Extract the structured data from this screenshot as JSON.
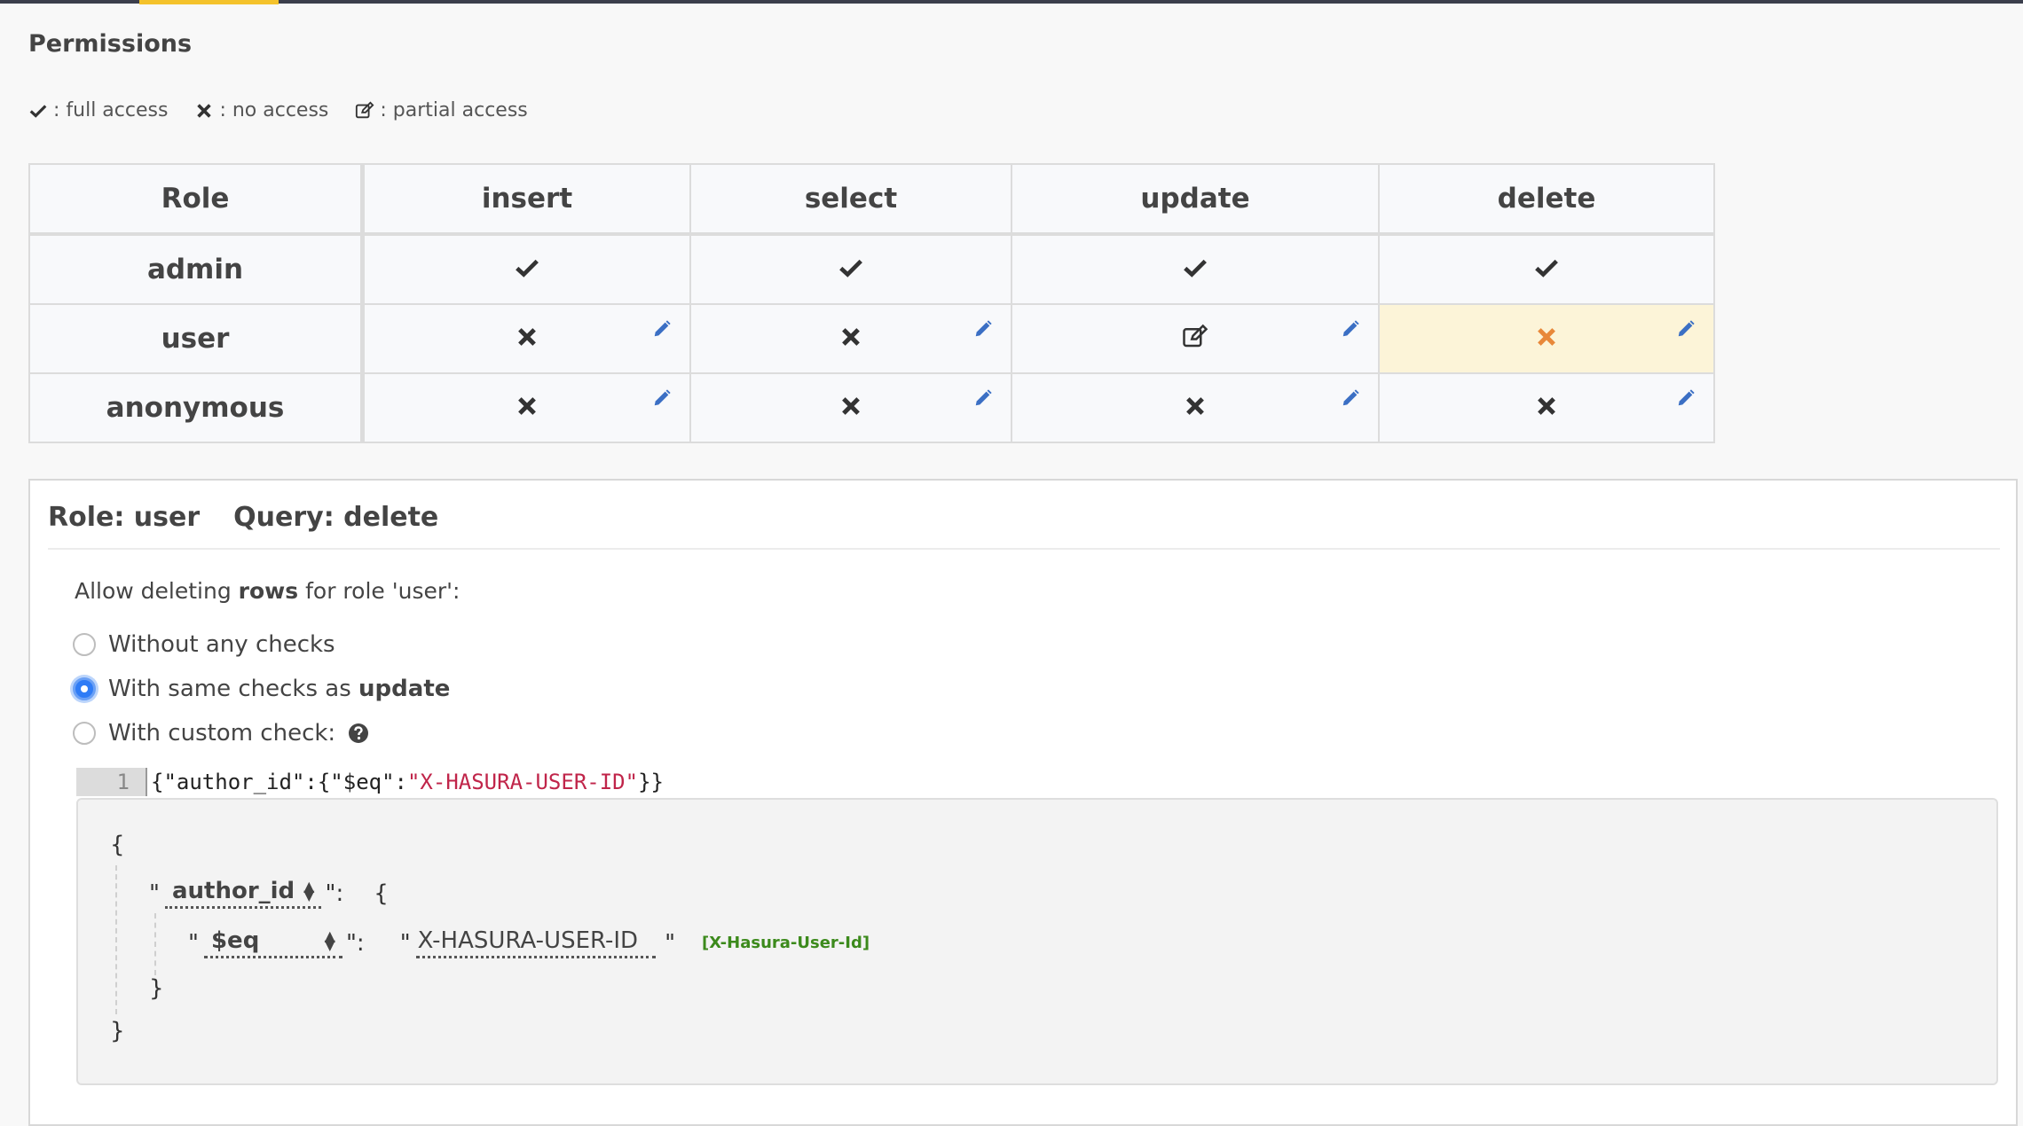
{
  "page": {
    "title": "Permissions"
  },
  "legend": {
    "full": ": full access",
    "none": ": no access",
    "partial": ": partial access"
  },
  "table": {
    "headers": [
      "Role",
      "insert",
      "select",
      "update",
      "delete"
    ],
    "rows": [
      {
        "role": "admin",
        "cells": [
          "full",
          "full",
          "full",
          "full"
        ]
      },
      {
        "role": "user",
        "cells": [
          "none",
          "none",
          "partial",
          "none"
        ]
      },
      {
        "role": "anonymous",
        "cells": [
          "none",
          "none",
          "none",
          "none"
        ]
      }
    ],
    "colors": {
      "icon": "#333333",
      "selected_icon": "#e8883a",
      "edit_icon": "#3b6fc4",
      "selected_bg": "#fcf4d8"
    }
  },
  "panel": {
    "role_label": "Role: user",
    "query_label": "Query: delete",
    "allow_prefix": "Allow deleting ",
    "allow_bold": "rows",
    "allow_suffix": " for role 'user':",
    "options": {
      "no_checks": "Without any checks",
      "same_prefix": "With same checks as ",
      "same_bold": "update",
      "custom": "With custom check:"
    },
    "selected_option": "same_checks"
  },
  "editor": {
    "line_number": "1",
    "code_open": "{\"author_id\":{\"$eq\":",
    "code_string": "\"X-HASURA-USER-ID\"",
    "code_close": "}}"
  },
  "builder": {
    "open_brace": "{",
    "close_brace": "}",
    "quote": "\"",
    "colon_quote": "\":",
    "column": "author_id",
    "operator": "$eq",
    "value": "X-HASURA-USER-ID",
    "session_var": "[X-Hasura-User-Id]"
  }
}
